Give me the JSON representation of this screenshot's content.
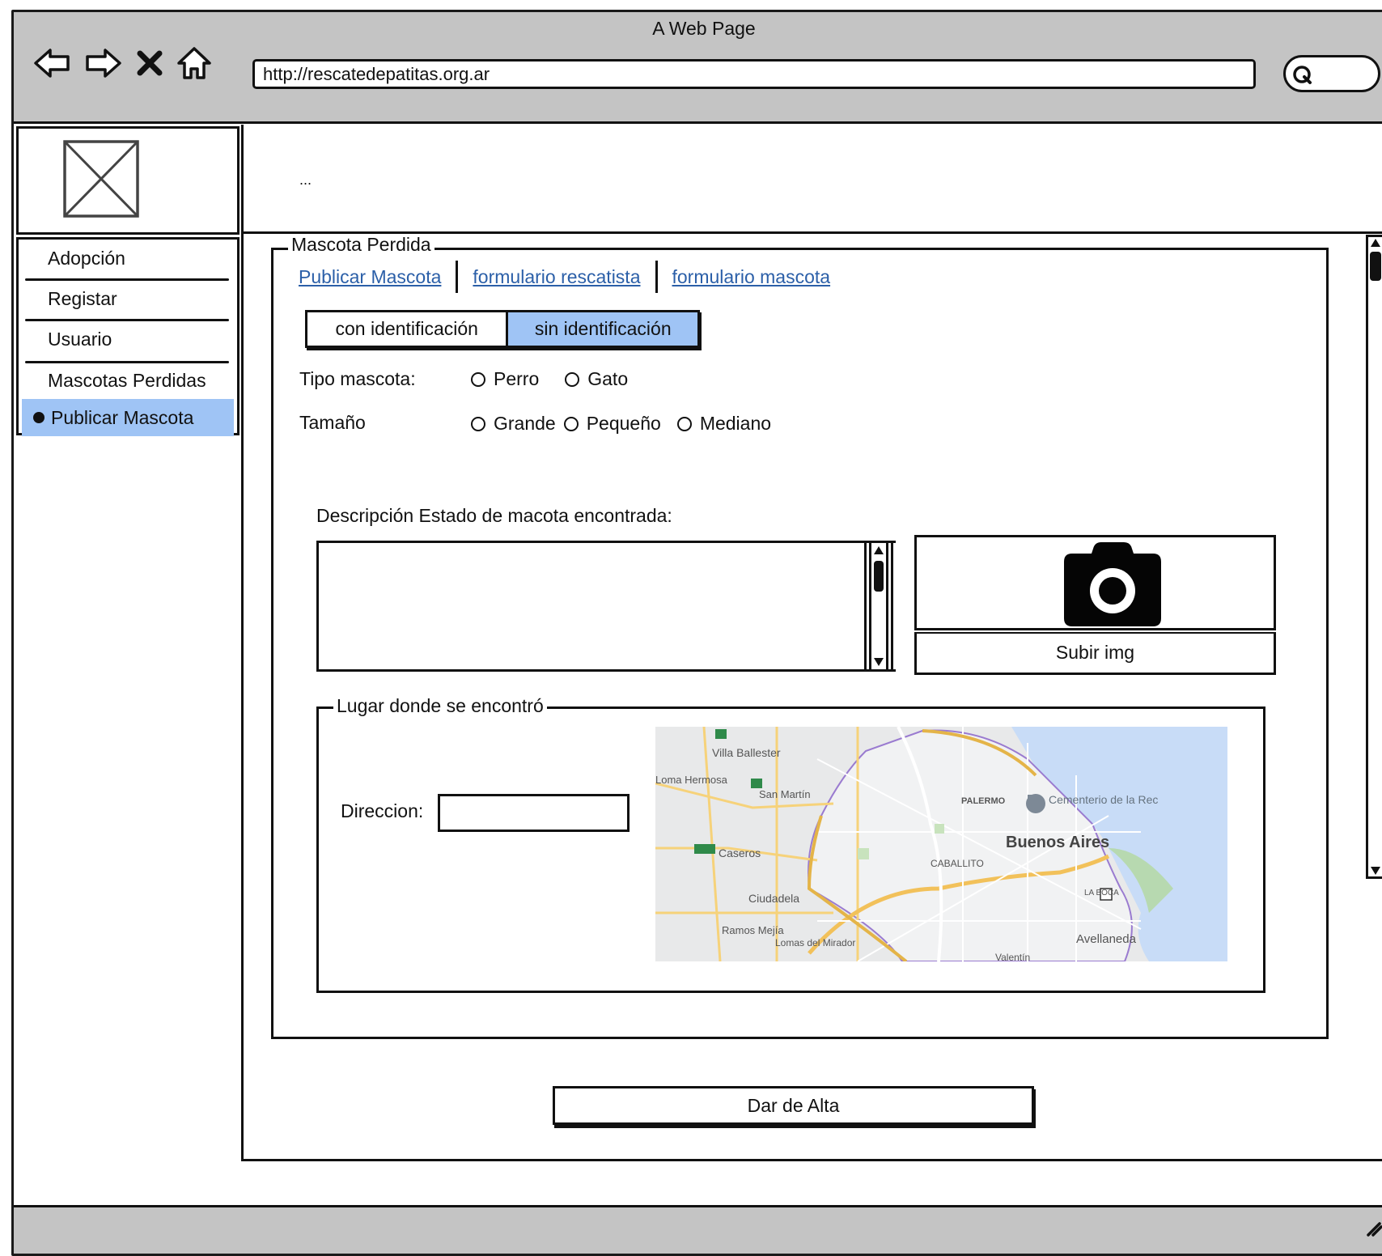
{
  "window": {
    "title": "A Web Page"
  },
  "browser": {
    "url": "http://rescatedepatitas.org.ar",
    "nav_icons": [
      "back-arrow-icon",
      "forward-arrow-icon",
      "close-x-icon",
      "home-icon"
    ],
    "search_icon": "search-icon"
  },
  "header": {
    "text": "..."
  },
  "sidebar": {
    "items": [
      {
        "label": "Adopción",
        "active": false
      },
      {
        "label": "Registar",
        "active": false
      },
      {
        "label": "Usuario",
        "active": false
      },
      {
        "label": "Mascotas Perdidas",
        "active": false
      },
      {
        "label": "Publicar Mascota",
        "active": true
      }
    ],
    "active_color": "#9fc4f5"
  },
  "form": {
    "legend": "Mascota Perdida",
    "links": [
      "Publicar Mascota",
      "formulario rescatista",
      "formulario mascota"
    ],
    "toggle": {
      "options": [
        "con identificación",
        "sin identificación"
      ],
      "selected": "sin identificación"
    },
    "tipo": {
      "label": "Tipo mascota:",
      "options": [
        "Perro",
        "Gato"
      ]
    },
    "tamano": {
      "label": "Tamaño",
      "options": [
        "Grande",
        "Pequeño",
        "Mediano"
      ]
    },
    "descripcion_label": "Descripción Estado de macota encontrada:",
    "upload_label": "Subir img",
    "lugar": {
      "legend": "Lugar donde se encontró",
      "direccion_label": "Direccion:",
      "map_labels": [
        "Villa Ballester",
        "Loma Hermosa",
        "San Martín",
        "Caseros",
        "Ciudadela",
        "Ramos Mejía",
        "Lomas del Mirador",
        "PALERMO",
        "Cementerio de la Rec",
        "Buenos Aires",
        "CABALLITO",
        "LA BOCA",
        "Avellaneda",
        "Valentín"
      ]
    }
  },
  "submit_label": "Dar de Alta"
}
